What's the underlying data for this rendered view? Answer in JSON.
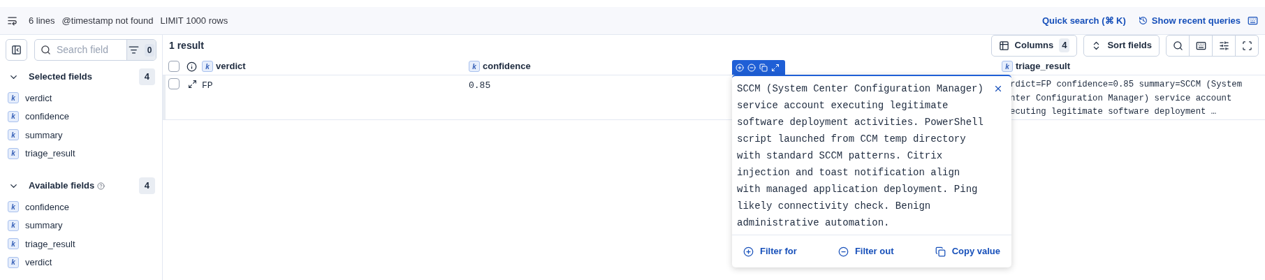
{
  "status_bar": {
    "lines": "6 lines",
    "timestamp": "@timestamp not found",
    "limit": "LIMIT 1000 rows",
    "quick_search": "Quick search (⌘ K)",
    "recent_queries": "Show recent queries"
  },
  "sidebar": {
    "search": {
      "placeholder": "Search field"
    },
    "filter_count": "0",
    "sections": [
      {
        "title": "Selected fields",
        "count": "4",
        "expanded": true,
        "help": false,
        "fields": [
          {
            "type": "k",
            "name": "verdict"
          },
          {
            "type": "k",
            "name": "confidence"
          },
          {
            "type": "k",
            "name": "summary"
          },
          {
            "type": "k",
            "name": "triage_result"
          }
        ]
      },
      {
        "title": "Available fields",
        "count": "4",
        "expanded": true,
        "help": true,
        "fields": [
          {
            "type": "k",
            "name": "confidence"
          },
          {
            "type": "k",
            "name": "summary"
          },
          {
            "type": "k",
            "name": "triage_result"
          },
          {
            "type": "k",
            "name": "verdict"
          }
        ]
      }
    ]
  },
  "results": {
    "title": "1 result",
    "columns_button": "Columns",
    "columns_count": "4",
    "sort_button": "Sort fields"
  },
  "table": {
    "all_checked": false,
    "columns": [
      {
        "type": "k",
        "name": "verdict"
      },
      {
        "type": "k",
        "name": "confidence"
      },
      {
        "type": "k",
        "name": "triage_result"
      }
    ],
    "rows": [
      {
        "checked": false,
        "verdict": "FP",
        "confidence": "0.85",
        "triage_result": [
          "rdict=FP confidence=0.85 summary=SCCM (System",
          "nter Configuration Manager) service account",
          "ecuting legitimate software deployment …"
        ]
      }
    ]
  },
  "popover": {
    "text": "SCCM (System Center Configuration Manager) service account executing legitimate software deployment activities. PowerShell script launched from CCM temp directory with standard SCCM patterns. Citrix injection and toast notification align with managed application deployment. Ping likely connectivity check. Benign administrative automation.",
    "actions": [
      {
        "kind": "filter_for",
        "label": "Filter for"
      },
      {
        "kind": "filter_out",
        "label": "Filter out"
      },
      {
        "kind": "copy",
        "label": "Copy value"
      }
    ]
  }
}
